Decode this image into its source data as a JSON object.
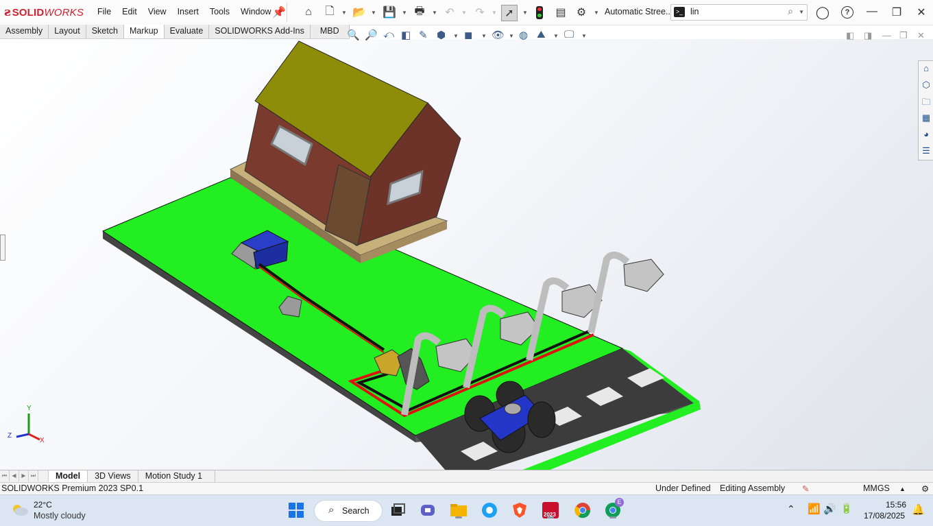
{
  "app": {
    "brand_prefix": "SOLID",
    "brand_suffix": "WORKS",
    "document_title": "Automatic Stree...",
    "search_value": "lin"
  },
  "menu": [
    "File",
    "Edit",
    "View",
    "Insert",
    "Tools",
    "Window"
  ],
  "command_tabs": [
    "Assembly",
    "Layout",
    "Sketch",
    "Markup",
    "Evaluate",
    "SOLIDWORKS Add-Ins",
    "MBD"
  ],
  "active_command_tab": "Markup",
  "bottom_tabs": [
    "Model",
    "3D Views",
    "Motion Study 1"
  ],
  "active_bottom_tab": "Model",
  "status": {
    "product": "SOLIDWORKS Premium 2023 SP0.1",
    "definition": "Under Defined",
    "mode": "Editing Assembly",
    "units": "MMGS"
  },
  "triad": {
    "x": "X",
    "y": "Y",
    "z": "Z"
  },
  "taskbar": {
    "temperature": "22°C",
    "condition": "Mostly cloudy",
    "search_label": "Search",
    "time": "15:56",
    "date": "17/08/2025",
    "sw_badge": "2023",
    "profile_badge": "E"
  },
  "colors": {
    "accent_red": "#d11f2f",
    "grass": "#22ee22",
    "road": "#3a3a3a",
    "roof": "#8d8d0a",
    "brick": "#7a3a2e",
    "car": "#2436c8"
  }
}
